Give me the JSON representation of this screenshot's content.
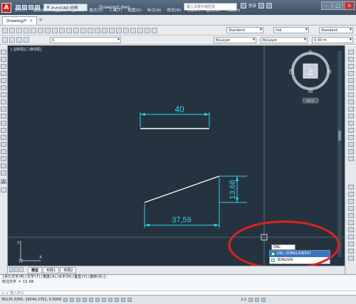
{
  "titlebar": {
    "workspace": "AutoCAD 经典",
    "doc_title": "Drawing2.dwg",
    "search_placeholder": "键入关键字或短语",
    "login": "登录"
  },
  "menu": [
    "文件(F)",
    "编辑(E)",
    "视图(V)",
    "插入(I)",
    "格式(O)",
    "工具(T)",
    "绘图(D)",
    "标注(N)",
    "修改(M)",
    "参数(P)",
    "窗口(W)",
    "帮助(H)"
  ],
  "doc_tab": {
    "label": "Drawing2*"
  },
  "toolbar": {
    "text_style": "Standard",
    "dim_style": "hsk",
    "table_style": "Standard",
    "layer": "0",
    "color": "ByLayer",
    "linetype": "ByLayer",
    "lineweight": "0.30 m"
  },
  "viewport_label": "[-][俯视][二维线框]",
  "viewcube": {
    "north": "北",
    "south": "南",
    "east": "东",
    "west": "西",
    "top": "上",
    "wcs": "WCS"
  },
  "dimensions": {
    "horizontal_top": "40",
    "vertical": "13,68",
    "horizontal_bottom": "37,59"
  },
  "ucs": {
    "y": "Y",
    "x": "X"
  },
  "layout_tabs": [
    "模型",
    "布局1",
    "布局2"
  ],
  "command_history": [
    "[多行文字(M)/文字(T)/角度(A)/水平(H)/垂直(V)/旋转(R)]:",
    "标注文字 = 13.68"
  ],
  "command_prompt": "键入命令",
  "autocomplete": {
    "typed": "DAL",
    "items": [
      "DAL (DIMALIGNED)",
      "3DALIGN"
    ]
  },
  "status": {
    "coords": "35135.3355, 18240.2751, 0.0000",
    "scale": "1:1"
  },
  "colors": {
    "canvas": "#253340",
    "dimension": "#33d1e6",
    "line": "#ffffff",
    "annotation_circle": "#e02020"
  }
}
